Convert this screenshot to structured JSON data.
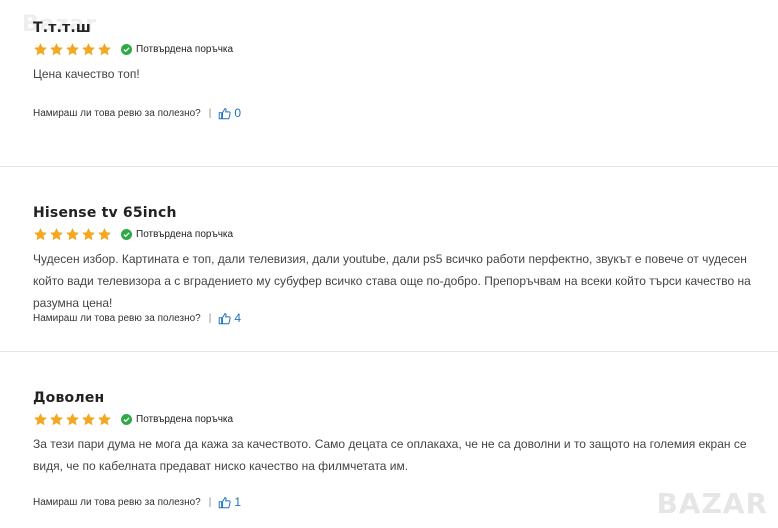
{
  "reviews": [
    {
      "title": "Т.т.т.ш",
      "verified": "Потвърдена поръчка",
      "rating": 5,
      "text": "Цена качество топ!",
      "helpful_question": "Намираш ли това ревю за полезно?",
      "helpful_count": "0"
    },
    {
      "title": "Hisense tv 65inch",
      "verified": "Потвърдена поръчка",
      "rating": 5,
      "text": "Чудесен избор. Картината е топ, дали телевизия, дали youtube, дали ps5 всичко работи перфектно, звукът е повече от чудесен който вади телевизора а с вградението му субуфер всичко става още по-добро. Препоръчвам на всеки който търси качество на разумна цена!",
      "helpful_question": "Намираш ли това ревю за полезно?",
      "helpful_count": "4"
    },
    {
      "title": "Доволен",
      "verified": "Потвърдена поръчка",
      "rating": 5,
      "text": "За тези пари дума не мога да кажа за качеството. Само децата се оплакаха, че не са доволни и то защото на големия екран се видя, че по кабелната предават ниско качество на филмчетата им.",
      "helpful_question": "Намираш ли това ревю за полезно?",
      "helpful_count": "1"
    }
  ],
  "colors": {
    "star": "#f5a623",
    "check": "#2eaa45",
    "link": "#1e73be"
  },
  "watermark_logo": "BAZAR"
}
